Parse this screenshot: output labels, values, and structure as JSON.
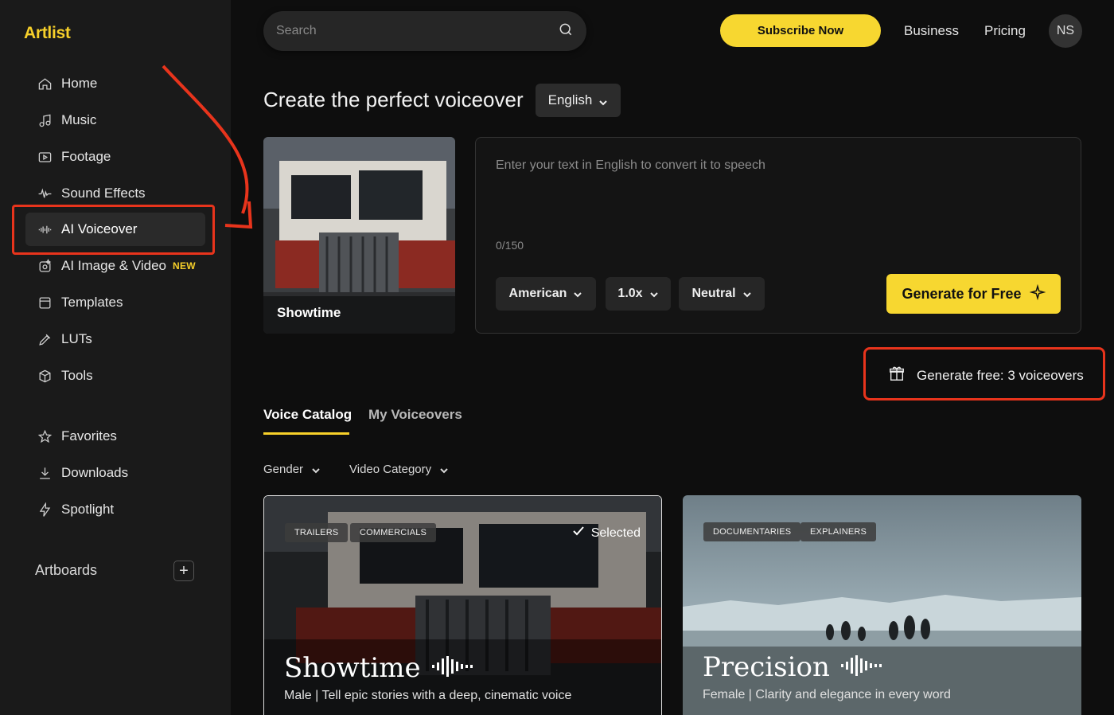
{
  "app": {
    "logo": "Artlist"
  },
  "sidebar": {
    "items": [
      {
        "label": "Home",
        "icon": "home-icon"
      },
      {
        "label": "Music",
        "icon": "music-note-icon"
      },
      {
        "label": "Footage",
        "icon": "footage-icon"
      },
      {
        "label": "Sound Effects",
        "icon": "waveform-icon"
      },
      {
        "label": "AI Voiceover",
        "icon": "voice-wave-icon",
        "active": true
      },
      {
        "label": "AI Image & Video",
        "icon": "ai-image-icon",
        "badge": "NEW"
      },
      {
        "label": "Templates",
        "icon": "templates-icon"
      },
      {
        "label": "LUTs",
        "icon": "eyedropper-icon"
      },
      {
        "label": "Tools",
        "icon": "box-icon"
      },
      {
        "label": "Favorites",
        "icon": "star-icon"
      },
      {
        "label": "Downloads",
        "icon": "download-icon"
      },
      {
        "label": "Spotlight",
        "icon": "bolt-icon"
      }
    ],
    "artboards_label": "Artboards",
    "artboards_add": "+"
  },
  "header": {
    "search_placeholder": "Search",
    "subscribe_label": "Subscribe Now",
    "business_label": "Business",
    "pricing_label": "Pricing",
    "avatar_initials": "NS"
  },
  "main": {
    "title": "Create the perfect voiceover",
    "language": "English",
    "thumbnail_label": "Showtime",
    "text_placeholder": "Enter your text in English to convert it to speech",
    "char_count": "0/150",
    "options": {
      "accent": "American",
      "speed": "1.0x",
      "tone": "Neutral"
    },
    "generate_label": "Generate for Free",
    "free_generations": "Generate free: 3 voiceovers",
    "tabs": [
      {
        "label": "Voice Catalog",
        "active": true
      },
      {
        "label": "My Voiceovers",
        "active": false
      }
    ],
    "filters": {
      "gender": "Gender",
      "category": "Video Category"
    },
    "cards": [
      {
        "title": "Showtime",
        "tags": [
          "TRAILERS",
          "COMMERCIALS"
        ],
        "selected_label": "Selected",
        "description": "Male | Tell epic stories with a deep, cinematic voice"
      },
      {
        "title": "Precision",
        "tags": [
          "DOCUMENTARIES",
          "EXPLAINERS"
        ],
        "description": "Female | Clarity and elegance in every word"
      }
    ]
  },
  "colors": {
    "accent": "#f7d730",
    "annotation": "#e8341c",
    "background": "#0e0e0e",
    "sidebar": "#1a1a1a"
  }
}
